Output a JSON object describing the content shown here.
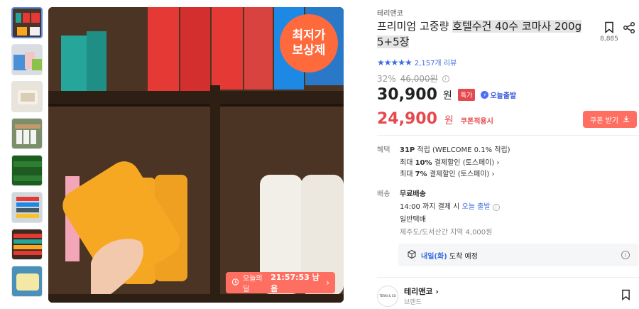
{
  "thumbnails": [
    {
      "name": "thumb-1",
      "active": true
    },
    {
      "name": "thumb-2",
      "active": false
    },
    {
      "name": "thumb-3",
      "active": false
    },
    {
      "name": "thumb-4",
      "active": false
    },
    {
      "name": "thumb-5",
      "active": false
    },
    {
      "name": "thumb-6",
      "active": false
    },
    {
      "name": "thumb-7",
      "active": false
    },
    {
      "name": "thumb-8",
      "active": false
    }
  ],
  "main_image": {
    "badge_line1": "최저가",
    "badge_line2": "보상제",
    "timer_label": "오늘의딜",
    "timer_value": "21:57:53 남음",
    "timer_icon": "alarm-clock-icon"
  },
  "product": {
    "brand": "테리앤코",
    "title_plain": "프리미엄 고중량 ",
    "title_highlight_1": "호텔수건 40수 코마사 200g",
    "title_highlight_2": "5+5장",
    "bookmark_count": "8,885",
    "rating_stars": "★★★★★",
    "review_count": "2,157개 리뷰",
    "discount_rate": "32%",
    "original_price": "46,000원",
    "price": "30,900",
    "price_unit": "원",
    "tag_special": "특가",
    "tag_today": "오늘출발",
    "coupon_price": "24,900",
    "coupon_unit": "원",
    "coupon_label": "쿠폰적용시",
    "coupon_button": "쿠폰 받기"
  },
  "benefits": {
    "label": "혜택",
    "point_amount": "31P",
    "point_text": "적립 (WELCOME 0.1% 적립)",
    "disc1_prefix": "최대 ",
    "disc1_pct": "10%",
    "disc1_text": " 결제할인 (토스페이)",
    "disc2_prefix": "최대 ",
    "disc2_pct": "7%",
    "disc2_text": " 결제할인 (토스페이)"
  },
  "shipping": {
    "label": "배송",
    "free": "무료배송",
    "cutoff_prefix": "14:00 까지 결제 시 ",
    "cutoff_highlight": "오늘 출발",
    "method": "일반택배",
    "extra": "제주도/도서산간 지역 4,000원",
    "arrival_highlight": "내일(화)",
    "arrival_text": " 도착 예정"
  },
  "seller": {
    "logo_text": "TERRI & CO",
    "name": "테리앤코",
    "sub": "브랜드"
  },
  "colors": {
    "accent_blue": "#3b6dde",
    "coupon_red": "#e5484d",
    "button_coral": "#ff6f61",
    "badge_orange": "#ff6a3d"
  }
}
